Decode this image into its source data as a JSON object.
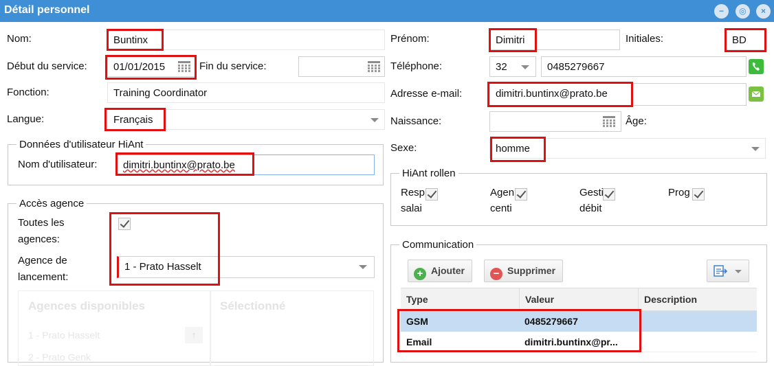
{
  "window": {
    "title": "Détail personnel",
    "controls": {
      "minimize_icon": "−",
      "restore_icon": "◎",
      "close_icon": "×"
    }
  },
  "left": {
    "nom": {
      "label": "Nom:",
      "value": "Buntinx"
    },
    "debut": {
      "label": "Début du service:",
      "value": "01/01/2015"
    },
    "fin": {
      "label": "Fin du service:",
      "value": ""
    },
    "fonction": {
      "label": "Fonction:",
      "value": "Training Coordinator"
    },
    "langue": {
      "label": "Langue:",
      "value": "Français"
    },
    "hiant_user": {
      "legend": "Données d'utilisateur HiAnt",
      "username_label": "Nom d'utilisateur:",
      "username_value": "dimitri.buntinx@prato.be"
    },
    "acces": {
      "legend": "Accès agence",
      "toutes_label_1": "Toutes les",
      "toutes_label_2": "agences:",
      "toutes_checked": true,
      "agence_label_1": "Agence de",
      "agence_label_2": "lancement:",
      "agence_value": "1 - Prato Hasselt",
      "disponibles_header": "Agences disponibles",
      "selectionne_header": "Sélectionné",
      "dispo_items": [
        "1 - Prato Hasselt",
        "2 - Prato Genk"
      ],
      "up_icon": "↑"
    }
  },
  "right": {
    "prenom": {
      "label": "Prénom:",
      "value": "Dimitri"
    },
    "initiales": {
      "label": "Initiales:",
      "value": "BD"
    },
    "telephone": {
      "label": "Téléphone:",
      "prefix": "32",
      "value": "0485279667"
    },
    "email": {
      "label": "Adresse e-mail:",
      "value": "dimitri.buntinx@prato.be"
    },
    "naissance": {
      "label": "Naissance:",
      "value": "",
      "age_label": "Âge:"
    },
    "sexe": {
      "label": "Sexe:",
      "value": "homme"
    },
    "roles": {
      "legend": "HiAnt rollen",
      "items": [
        {
          "line1": "Resp",
          "line2": "salai",
          "checked": true
        },
        {
          "line1": "Agen",
          "line2": "centi",
          "checked": true
        },
        {
          "line1": "Gesti",
          "line2": "débit",
          "checked": true
        },
        {
          "line1": "Prog",
          "line2": "",
          "checked": true
        }
      ]
    },
    "communication": {
      "legend": "Communication",
      "add_label": "Ajouter",
      "delete_label": "Supprimer",
      "columns": [
        "Type",
        "Valeur",
        "Description"
      ],
      "rows": [
        {
          "type": "GSM",
          "valeur": "0485279667",
          "description": ""
        },
        {
          "type": "Email",
          "valeur": "dimitri.buntinx@pr...",
          "description": ""
        }
      ]
    }
  },
  "colors": {
    "titlebar": "#3f8fd6",
    "highlight": "#e01010",
    "selected_row": "#c5dcf2"
  },
  "icons": [
    "calendar-icon",
    "phone-icon",
    "mail-icon",
    "plus-icon",
    "minus-icon",
    "export-icon"
  ]
}
